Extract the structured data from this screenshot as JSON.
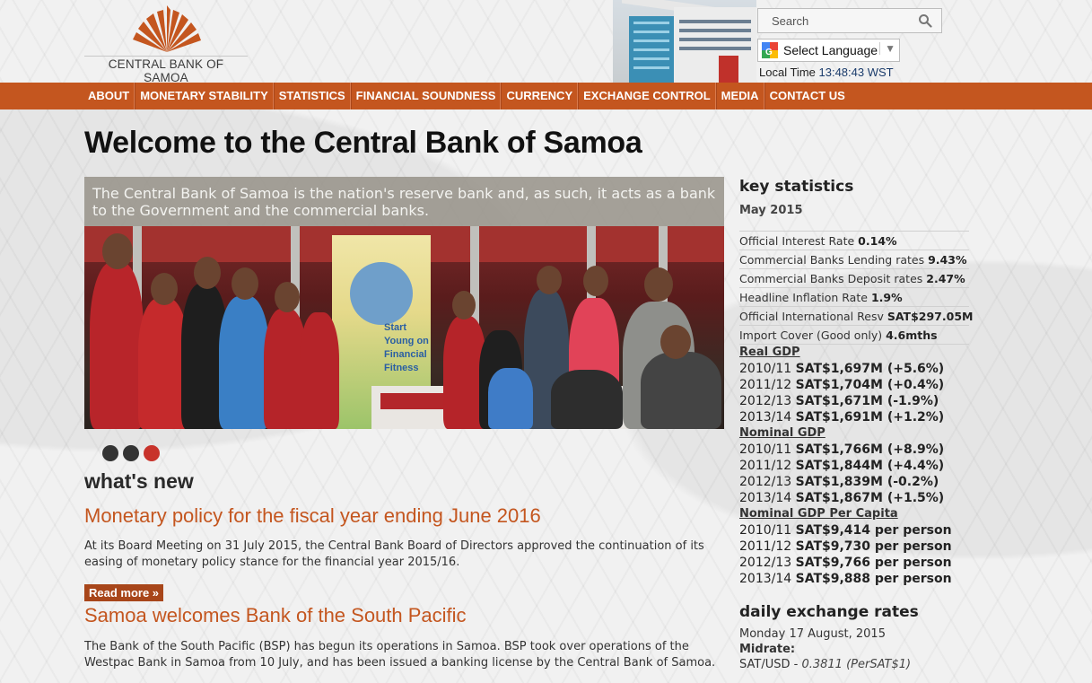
{
  "header": {
    "logo_text": "CENTRAL BANK OF SAMOA",
    "search_placeholder": "Search",
    "language_label": "Select Language",
    "local_time_label": "Local Time",
    "local_time_value": "13:48:43",
    "local_time_zone": "WST"
  },
  "nav": {
    "items": [
      {
        "label": "ABOUT"
      },
      {
        "label": "MONETARY STABILITY"
      },
      {
        "label": "STATISTICS"
      },
      {
        "label": "FINANCIAL SOUNDNESS"
      },
      {
        "label": "CURRENCY"
      },
      {
        "label": "EXCHANGE CONTROL"
      },
      {
        "label": "MEDIA"
      },
      {
        "label": "CONTACT US"
      }
    ]
  },
  "main": {
    "title": "Welcome to the Central Bank of Samoa",
    "banner_caption": "The Central Bank of Samoa is the nation's reserve bank and, as such, it acts as a bank to the Government and the commercial banks.",
    "poster_text": "Start Young on Financial Fitness",
    "carousel_active_index": 3,
    "whats_new": "what's new",
    "news": [
      {
        "title": "Monetary policy for the fiscal year ending June 2016",
        "body": "At its Board Meeting on 31 July 2015, the Central Bank Board of Directors approved the continuation of its easing of monetary policy stance for the financial year 2015/16.",
        "read_more": "Read more »"
      },
      {
        "title": "Samoa welcomes Bank of the South Pacific",
        "body": "The Bank of the South Pacific (BSP) has begun its operations in Samoa. BSP took over operations of the Westpac Bank in Samoa from 10 July, and has been issued a banking license by the Central Bank of Samoa."
      }
    ]
  },
  "sidebar": {
    "key_stats_title": "key statistics",
    "month": "May 2015",
    "stats": [
      {
        "label": "Official Interest Rate",
        "value": "0.14%"
      },
      {
        "label": "Commercial Banks Lending rates",
        "value": "9.43%"
      },
      {
        "label": "Commercial Banks Deposit rates",
        "value": "2.47%"
      },
      {
        "label": "Headline Inflation Rate",
        "value": "1.9%"
      },
      {
        "label": "Official International Resv",
        "value": "SAT$297.05M"
      },
      {
        "label": "Import Cover (Good only)",
        "value": "4.6mths"
      }
    ],
    "real_gdp": {
      "title": "Real GDP",
      "rows": [
        {
          "year": "2010/11",
          "value": "SAT$1,697M (+5.6%)"
        },
        {
          "year": "2011/12",
          "value": "SAT$1,704M (+0.4%)"
        },
        {
          "year": "2012/13",
          "value": "SAT$1,671M (-1.9%)"
        },
        {
          "year": "2013/14",
          "value": "SAT$1,691M (+1.2%)"
        }
      ]
    },
    "nominal_gdp": {
      "title": "Nominal GDP",
      "rows": [
        {
          "year": "2010/11",
          "value": "SAT$1,766M (+8.9%)"
        },
        {
          "year": "2011/12",
          "value": "SAT$1,844M (+4.4%)"
        },
        {
          "year": "2012/13",
          "value": "SAT$1,839M (-0.2%)"
        },
        {
          "year": "2013/14",
          "value": "SAT$1,867M (+1.5%)"
        }
      ]
    },
    "nominal_gdp_pc": {
      "title": "Nominal GDP Per Capita",
      "rows": [
        {
          "year": "2010/11",
          "value": "SAT$9,414 per person"
        },
        {
          "year": "2011/12",
          "value": "SAT$9,730 per person"
        },
        {
          "year": "2012/13",
          "value": "SAT$9,766 per person"
        },
        {
          "year": "2013/14",
          "value": "SAT$9,888 per person"
        }
      ]
    },
    "fx": {
      "title": "daily exchange rates",
      "date": "Monday 17 August, 2015",
      "midrate_label": "Midrate:",
      "pair": "SAT/USD",
      "rate": "0.3811 (PerSAT$1)"
    }
  },
  "colors": {
    "nav_bg": "#c4561f",
    "accent": "#c4561f",
    "read_more_bg": "#a8461a",
    "carousel_active": "#c8332b"
  }
}
